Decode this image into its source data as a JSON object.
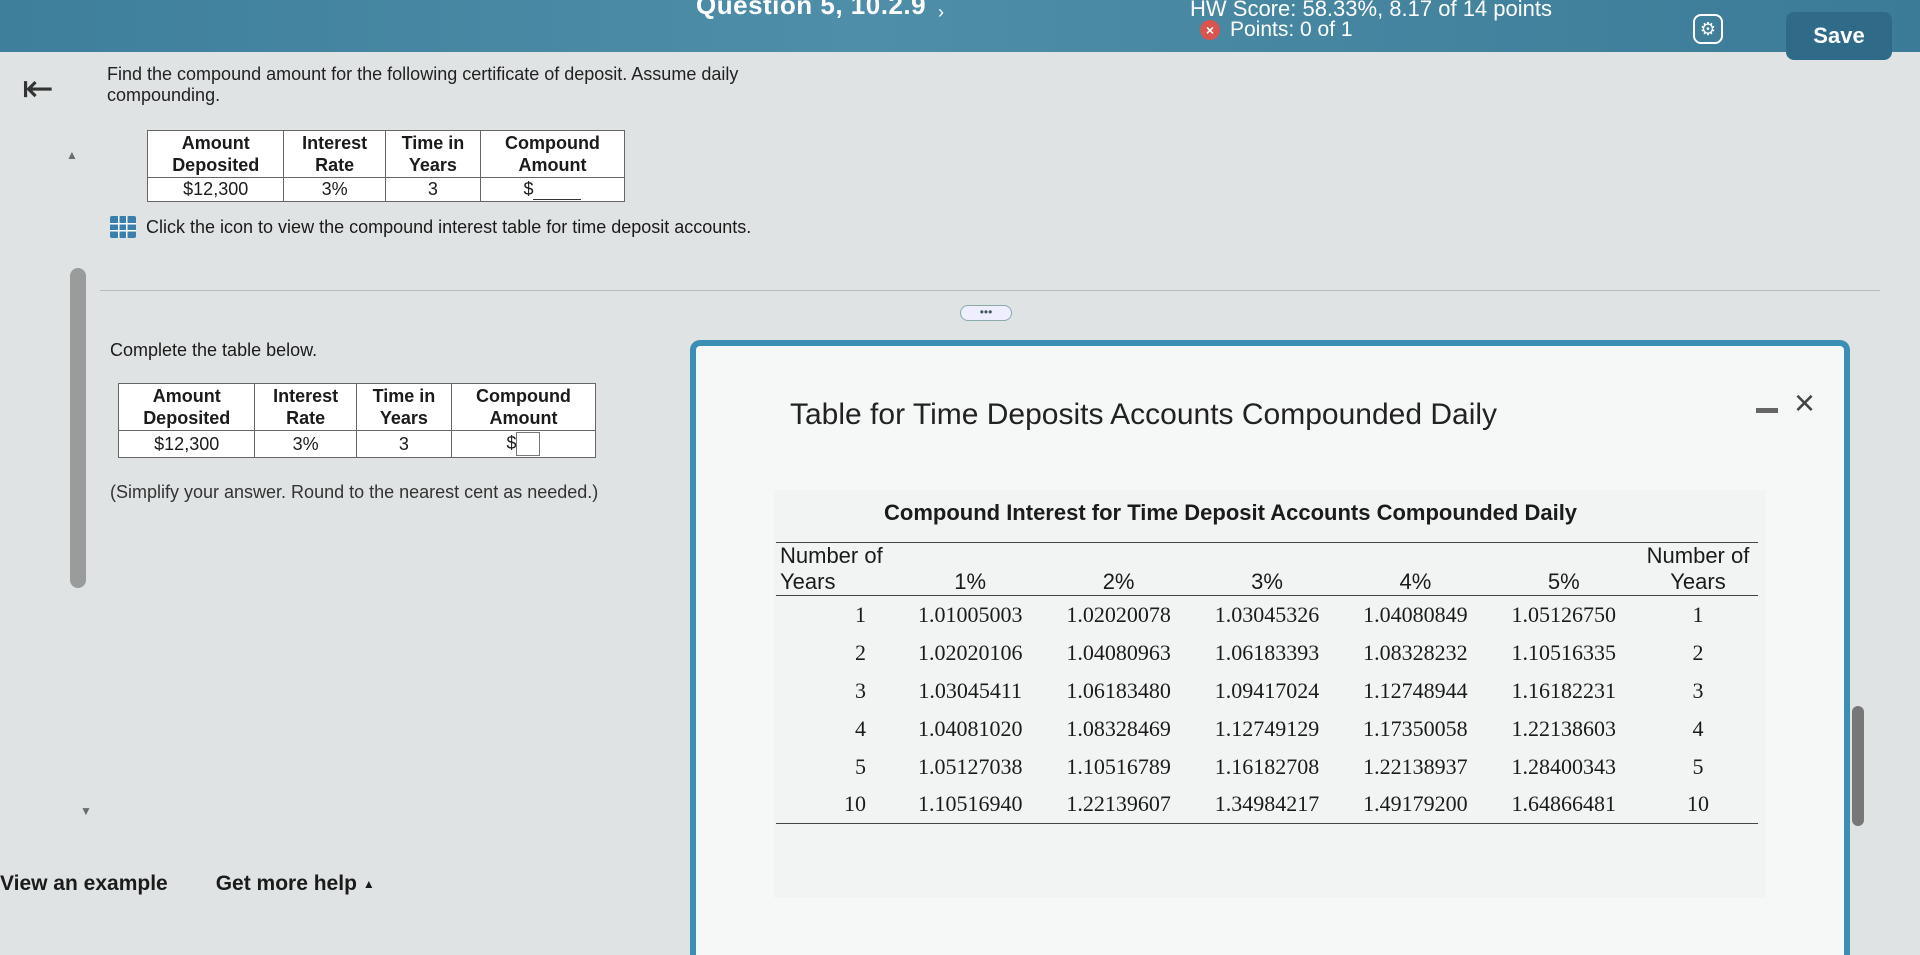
{
  "header": {
    "question": "Question 5, 10.2.9",
    "hw_score": "HW Score: 58.33%, 8.17 of 14 points",
    "points": "Points: 0 of 1",
    "save_label": "Save"
  },
  "prompt": "Find the compound amount for the following certificate of deposit. Assume daily compounding.",
  "problem_table": {
    "headers": [
      "Amount Deposited",
      "Interest Rate",
      "Time in Years",
      "Compound Amount"
    ],
    "amount": "$12,300",
    "rate": "3%",
    "time": "3",
    "compound_prefix": "$"
  },
  "icon_link": "Click the icon to view the compound interest table for time deposit accounts.",
  "complete_label": "Complete the table below.",
  "simplify_label": "(Simplify your answer. Round to the nearest cent as needed.)",
  "bottom": {
    "example": "View an example",
    "help": "Get more help",
    "help_arrow": "▲"
  },
  "modal": {
    "title": "Table for Time Deposits Accounts Compounded Daily",
    "table_title": "Compound Interest for Time Deposit Accounts Compounded Daily",
    "col_headers": [
      "Number of Years",
      "1%",
      "2%",
      "3%",
      "4%",
      "5%",
      "Number of Years"
    ],
    "rows": [
      {
        "years": "1",
        "v": [
          "1.01005003",
          "1.02020078",
          "1.03045326",
          "1.04080849",
          "1.05126750"
        ]
      },
      {
        "years": "2",
        "v": [
          "1.02020106",
          "1.04080963",
          "1.06183393",
          "1.08328232",
          "1.10516335"
        ]
      },
      {
        "years": "3",
        "v": [
          "1.03045411",
          "1.06183480",
          "1.09417024",
          "1.12748944",
          "1.16182231"
        ]
      },
      {
        "years": "4",
        "v": [
          "1.04081020",
          "1.08328469",
          "1.12749129",
          "1.17350058",
          "1.22138603"
        ]
      },
      {
        "years": "5",
        "v": [
          "1.05127038",
          "1.10516789",
          "1.16182708",
          "1.22138937",
          "1.28400343"
        ]
      },
      {
        "years": "10",
        "v": [
          "1.10516940",
          "1.22139607",
          "1.34984217",
          "1.49179200",
          "1.64866481"
        ]
      }
    ]
  }
}
